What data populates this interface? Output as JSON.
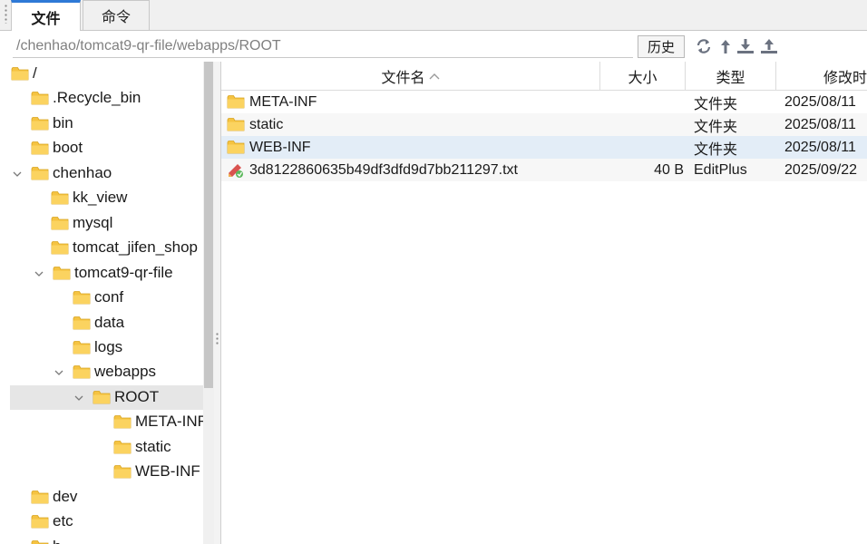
{
  "tabs": [
    {
      "label": "文件",
      "active": true
    },
    {
      "label": "命令",
      "active": false
    }
  ],
  "path": {
    "value": "/chenhao/tomcat9-qr-file/webapps/ROOT"
  },
  "toolbar": {
    "history_label": "历史",
    "icons": [
      "refresh-icon",
      "up-arrow-icon",
      "download-icon",
      "upload-icon"
    ]
  },
  "tree": {
    "items": [
      {
        "label": "/"
      },
      {
        "label": ".Recycle_bin"
      },
      {
        "label": "bin"
      },
      {
        "label": "boot"
      },
      {
        "label": "chenhao"
      },
      {
        "label": "kk_view"
      },
      {
        "label": "mysql"
      },
      {
        "label": "tomcat_jifen_shop"
      },
      {
        "label": "tomcat9-qr-file"
      },
      {
        "label": "conf"
      },
      {
        "label": "data"
      },
      {
        "label": "logs"
      },
      {
        "label": "webapps"
      },
      {
        "label": "ROOT"
      },
      {
        "label": "META-INF"
      },
      {
        "label": "static"
      },
      {
        "label": "WEB-INF"
      },
      {
        "label": "dev"
      },
      {
        "label": "etc"
      },
      {
        "label": "h"
      }
    ],
    "selected": "ROOT"
  },
  "columns": {
    "name": "文件名",
    "size": "大小",
    "type": "类型",
    "modified": "修改时"
  },
  "files": [
    {
      "name": "META-INF",
      "size": "",
      "type": "文件夹",
      "modified": "2025/08/11",
      "icon": "folder-icon"
    },
    {
      "name": "static",
      "size": "",
      "type": "文件夹",
      "modified": "2025/08/11",
      "icon": "folder-icon"
    },
    {
      "name": "WEB-INF",
      "size": "",
      "type": "文件夹",
      "modified": "2025/08/11",
      "icon": "folder-icon"
    },
    {
      "name": "3d8122860635b49df3dfd9d7bb211297.txt",
      "size": "40 B",
      "type": "EditPlus",
      "modified": "2025/09/22",
      "icon": "editplus-file-icon"
    }
  ],
  "colors": {
    "accent": "#2e79d6",
    "folder": "#f5c342",
    "selection": "#e3edf7"
  }
}
